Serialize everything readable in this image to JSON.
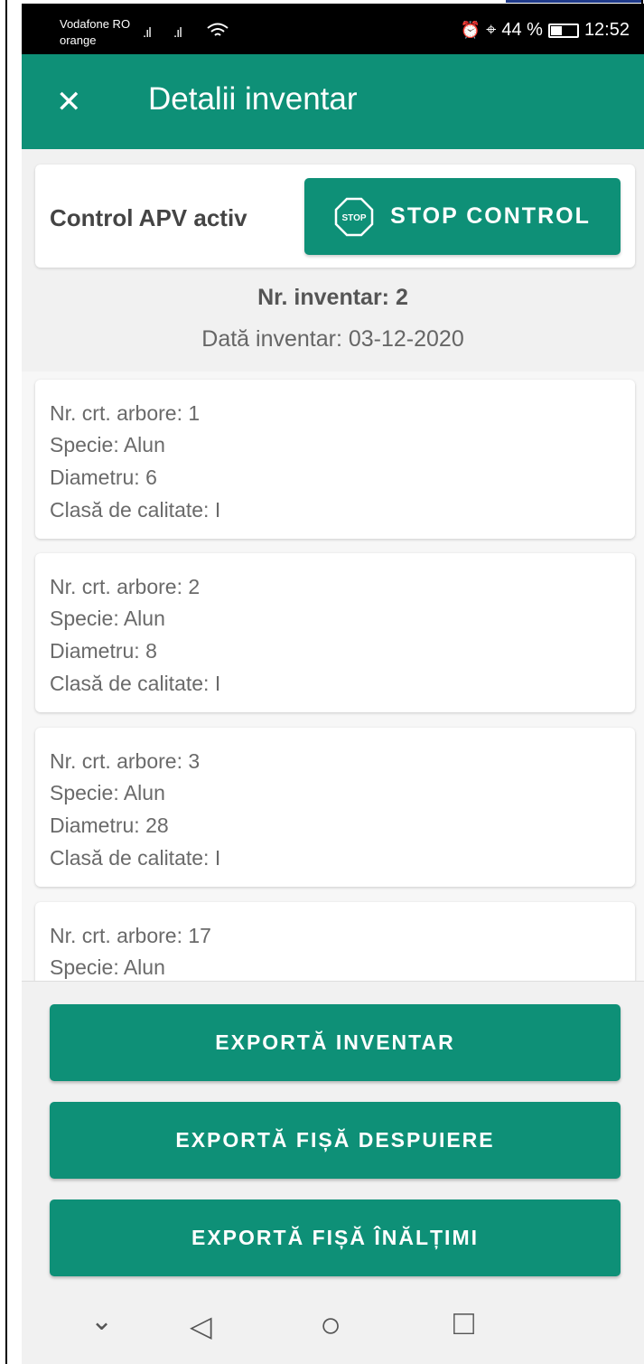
{
  "status_bar": {
    "carrier_line1": "Vodafone RO",
    "carrier_line2": "orange",
    "signal1": ".ıl",
    "signal2": ".ıl",
    "wifi_icon": "wifi-icon",
    "alarm_icon": "⏰",
    "location_icon": "⌖",
    "battery_text": "44 %",
    "battery_level": 0.44,
    "time": "12:52"
  },
  "app_bar": {
    "close_glyph": "✕",
    "title": "Detalii inventar"
  },
  "control": {
    "label": "Control APV activ",
    "stop_icon_text": "STOP",
    "stop_button": "STOP CONTROL"
  },
  "inventory": {
    "number": "Nr. inventar: 2",
    "date": "Dată inventar: 03-12-2020"
  },
  "trees": [
    {
      "nr": "Nr. crt. arbore: 1",
      "specie": "Specie: Alun",
      "diametru": "Diametru: 6",
      "clasa": "Clasă de calitate: I"
    },
    {
      "nr": "Nr. crt. arbore: 2",
      "specie": "Specie: Alun",
      "diametru": "Diametru: 8",
      "clasa": "Clasă de calitate: I"
    },
    {
      "nr": "Nr. crt. arbore: 3",
      "specie": "Specie: Alun",
      "diametru": "Diametru: 28",
      "clasa": "Clasă de calitate: I"
    },
    {
      "nr": "Nr. crt. arbore: 17",
      "specie": "Specie: Alun",
      "diametru": "",
      "clasa": ""
    }
  ],
  "actions": {
    "export_inventar": "EXPORTĂ INVENTAR",
    "export_despuiere": "EXPORTĂ FIȘĂ DESPUIERE",
    "export_inaltimi": "EXPORTĂ FIȘĂ ÎNĂLȚIMI"
  },
  "nav": {
    "chevron": "⌄",
    "back": "◁",
    "home": "○",
    "recents": "□"
  },
  "colors": {
    "accent": "#0e9077",
    "background": "#f1f1f1"
  }
}
